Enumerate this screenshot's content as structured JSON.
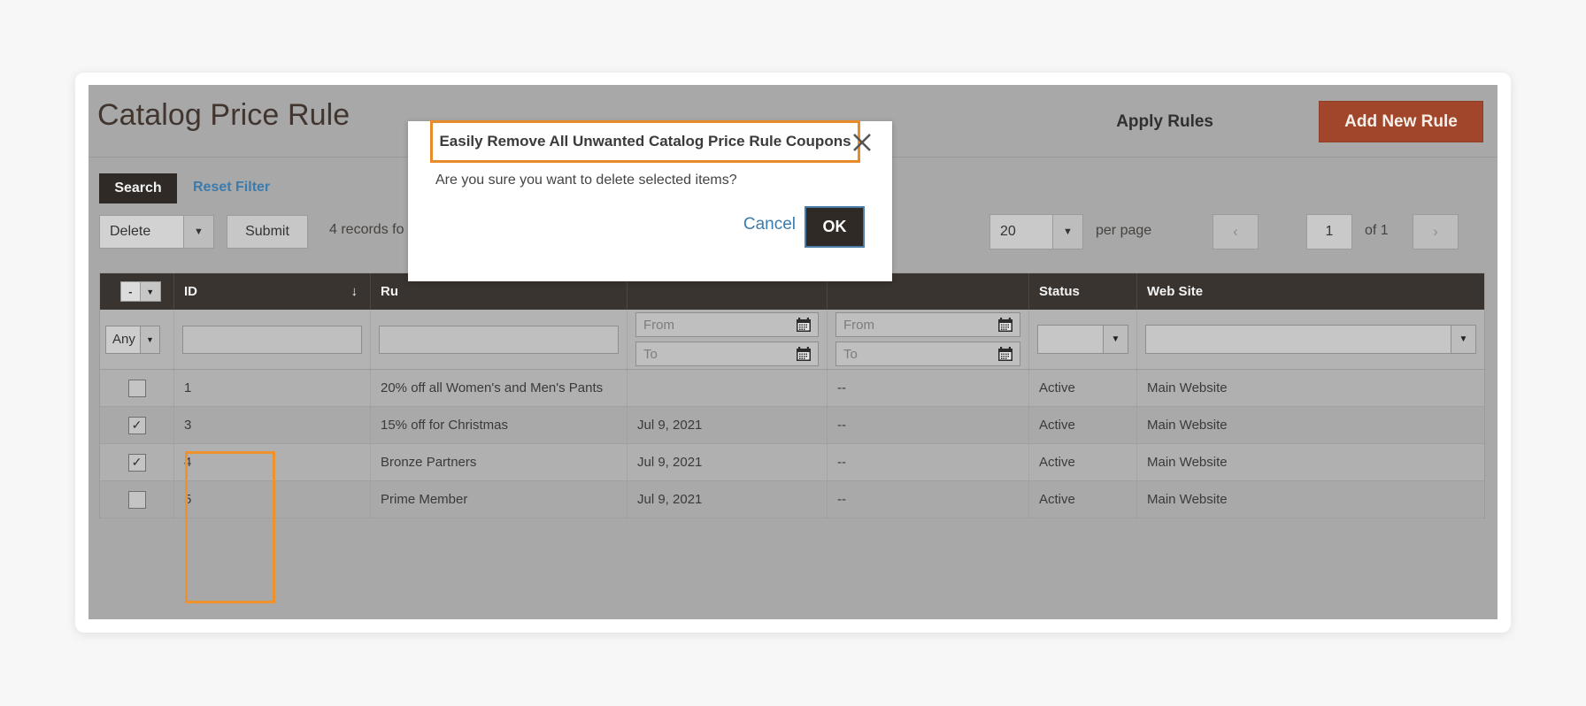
{
  "header": {
    "title": "Catalog Price Rule",
    "apply_rules_label": "Apply Rules",
    "add_new_rule_label": "Add New Rule"
  },
  "toolbar": {
    "search_label": "Search",
    "reset_filter_label": "Reset Filter",
    "mass_action_value": "Delete",
    "submit_label": "Submit",
    "records_found": "4 records fo"
  },
  "pagination": {
    "per_page_value": "20",
    "per_page_label": "per page",
    "prev_icon": "chevron-left-icon",
    "next_icon": "chevron-right-icon",
    "current_page": "1",
    "of_label": "of 1"
  },
  "grid": {
    "columns": [
      {
        "key": "checkbox",
        "label": ""
      },
      {
        "key": "id",
        "label": "ID",
        "sort_icon": "↓"
      },
      {
        "key": "rule",
        "label": "Ru"
      },
      {
        "key": "start",
        "label": ""
      },
      {
        "key": "end",
        "label": ""
      },
      {
        "key": "status",
        "label": "Status"
      },
      {
        "key": "website",
        "label": "Web Site"
      }
    ],
    "filters": {
      "checkbox_select_value": "Any",
      "id_value": "",
      "rule_value": "",
      "start_from_placeholder": "From",
      "start_to_placeholder": "To",
      "end_from_placeholder": "From",
      "end_to_placeholder": "To",
      "status_value": "",
      "website_value": ""
    },
    "header_select_value": "-",
    "rows": [
      {
        "checked": false,
        "id": "1",
        "rule": "20% off all Women's and Men's Pants",
        "start": "",
        "end": "--",
        "status": "Active",
        "website": "Main Website"
      },
      {
        "checked": true,
        "id": "3",
        "rule": "15% off for Christmas",
        "start": "Jul 9, 2021",
        "end": "--",
        "status": "Active",
        "website": "Main Website"
      },
      {
        "checked": true,
        "id": "4",
        "rule": "Bronze Partners",
        "start": "Jul 9, 2021",
        "end": "--",
        "status": "Active",
        "website": "Main Website"
      },
      {
        "checked": false,
        "id": "5",
        "rule": "Prime Member",
        "start": "Jul 9, 2021",
        "end": "--",
        "status": "Active",
        "website": "Main Website"
      }
    ]
  },
  "modal": {
    "title": "Easily Remove All Unwanted Catalog Price Rule Coupons",
    "message": "Are you sure you want to delete selected items?",
    "cancel_label": "Cancel",
    "ok_label": "OK",
    "close_icon": "close-icon"
  },
  "colors": {
    "accent_orange": "#e88b28",
    "brand_button": "#a1462a",
    "link_blue": "#3b7bad",
    "dark_header": "#393430",
    "page_bg": "#a8a8a8"
  },
  "checkbox_glyphs": {
    "checked": "✓",
    "unchecked": ""
  }
}
